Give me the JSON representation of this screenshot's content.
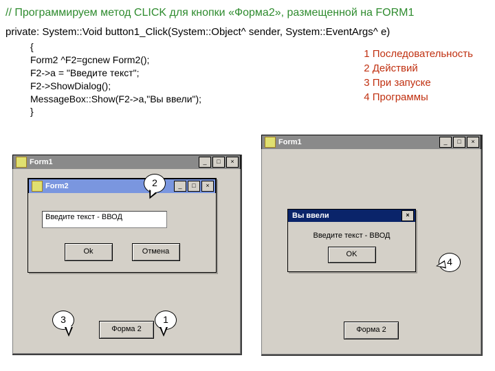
{
  "title": "// Программируем метод CLICK для кнопки «Форма2», размещенной на FORM1",
  "code": {
    "sig": "private: System::Void button1_Click(System::Object^  sender, System::EventArgs^  e)",
    "l1": "{",
    "l2": "Form2 ^F2=gcnew Form2();",
    "l3": "F2->a = \"Введите текст\";",
    "l4": "F2->ShowDialog();",
    "l5": "MessageBox::Show(F2->a,\"Вы ввели\");",
    "l6": "}"
  },
  "legend": {
    "i1": "1 Последовательность",
    "i2": "2 Действий",
    "i3": "3 При запуске",
    "i4": "4 Программы"
  },
  "left": {
    "form1_title": "Form1",
    "form2_title": "Form2",
    "textbox_value": "Введите текст - ВВОД",
    "ok": "Ok",
    "cancel": "Отмена",
    "forma2": "Форма 2",
    "min": "_",
    "max": "□",
    "close": "×"
  },
  "right": {
    "form1_title": "Form1",
    "msg_title": "Вы ввели",
    "msg_text": "Введите текст - ВВОД",
    "ok": "OK",
    "forma2": "Форма 2",
    "min": "_",
    "max": "□",
    "close": "×"
  },
  "callouts": {
    "c1": "1",
    "c2": "2",
    "c3": "3",
    "c4": "4"
  }
}
